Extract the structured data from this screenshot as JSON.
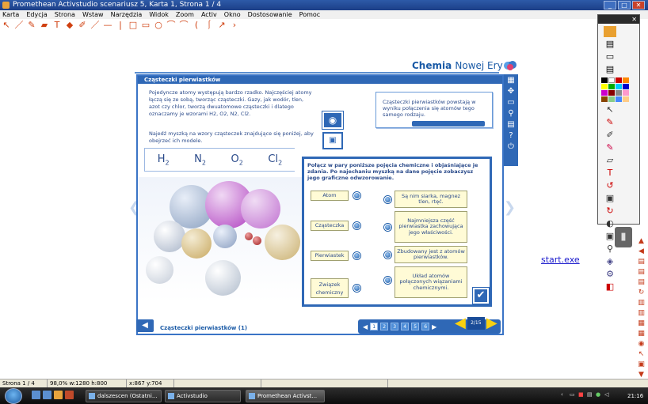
{
  "window": {
    "title": "Promethean Activstudio  scenariusz 5,  Karta 1,  Strona 1 / 4"
  },
  "menu": [
    "Karta",
    "Edycja",
    "Strona",
    "Wstaw",
    "Narzędzia",
    "Widok",
    "Zoom",
    "Activ",
    "Okno",
    "Dostosowanie",
    "Pomoc"
  ],
  "toolbar_icons": [
    "arrow-icon",
    "pen-icon",
    "highlighter-icon",
    "eraser-icon",
    "text-icon",
    "fill-icon",
    "dropper-icon",
    "line-icon",
    "line-icon",
    "divider-icon",
    "rectangle-icon",
    "rectangle-icon",
    "circle-icon",
    "curve-icon",
    "arc-icon",
    "curve-icon",
    "arc-icon",
    "arrow-line-icon",
    "polyline-icon"
  ],
  "brand": {
    "name_bold": "Chemia",
    "name_rest": "Nowej Ery",
    "number": "1"
  },
  "lesson": {
    "header": "Cząsteczki pierwiastków",
    "intro_line1": "Pojedyncze atomy występują bardzo rzadko. Najczęściej atomy łączą się ze sobą, tworząc cząsteczki. Gazy, jak wodór, tlen, azot czy chlor, tworzą dwuatomowe cząsteczki i dlatego oznaczamy je wzorami H",
    "intro_formula_tail": "2, O2, N2, Cl2.",
    "intro_line2": "Najedź myszką na wzory cząsteczek znajdujące się poniżej, aby obejrzeć ich modele.",
    "definition": "Cząsteczki pierwiastków powstają w wyniku połączenia się atomów tego samego rodzaju.",
    "formulas": [
      {
        "sym": "H",
        "sub": "2"
      },
      {
        "sym": "N",
        "sub": "2"
      },
      {
        "sym": "O",
        "sub": "2"
      },
      {
        "sym": "Cl",
        "sub": "2"
      }
    ],
    "exercise_title": "Połącz w pary poniższe pojęcia chemiczne i objaśniające je zdania. Po najechaniu myszką na dane pojęcie zobaczysz jego graficzne odwzorowanie.",
    "terms": [
      "Atom",
      "Cząsteczka",
      "Pierwiastek",
      "Związek chemiczny"
    ],
    "definitions": [
      "Są nim siarka, magnez tlen, rtęć.",
      "Najmniejsza część pierwiastka zachowująca jego właściwości.",
      "Zbudowany jest z atomów pierwiastków.",
      "Układ atomów połączonych wiązaniami chemicznymi."
    ],
    "footer_title": "Cząsteczki pierwiastków (1)",
    "pages": [
      "1",
      "2",
      "3",
      "4",
      "5",
      "6"
    ],
    "active_page": "1",
    "counter": "2/15"
  },
  "desktop": {
    "link": "start.exe"
  },
  "statusbar": {
    "page": "Strona 1 / 4",
    "zoom": "98,0% w:1280 h:800",
    "coords": "x:867 y:704"
  },
  "taskbar": {
    "items": [
      "dalszescen (Ostatni...",
      "Activstudio",
      "Promethean Activst..."
    ],
    "clock": "21:16"
  },
  "colors": {
    "accent": "#2f68b6",
    "brand": "#1a5aa6",
    "card": "#fffbd6",
    "arrow": "#f8d010"
  }
}
